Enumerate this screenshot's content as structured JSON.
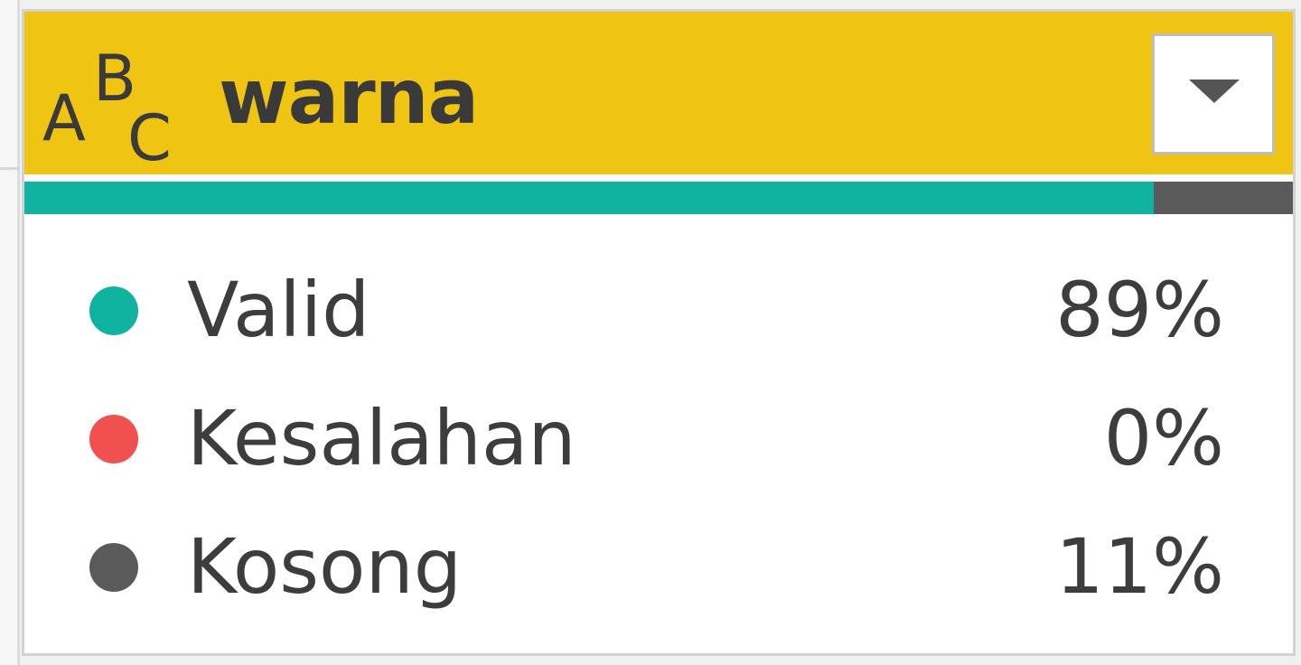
{
  "column": {
    "type_icon": "abc-text-type-icon",
    "type_icon_letters": "ABC",
    "name": "warna",
    "dropdown_icon": "chevron-down-icon"
  },
  "colors": {
    "header_bg": "#f0c412",
    "valid": "#10b3a0",
    "error": "#f05050",
    "empty": "#5a5a5a"
  },
  "quality": {
    "valid_fraction": 0.89,
    "error_fraction": 0.0,
    "empty_fraction": 0.11
  },
  "stats": [
    {
      "label": "Valid",
      "value": "89%"
    },
    {
      "label": "Kesalahan",
      "value": "0%"
    },
    {
      "label": "Kosong",
      "value": "11%"
    }
  ]
}
